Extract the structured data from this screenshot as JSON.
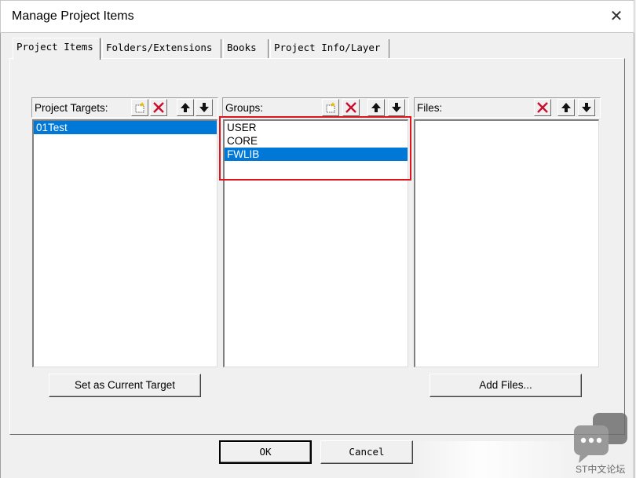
{
  "window": {
    "title": "Manage Project Items",
    "close_glyph": "✕"
  },
  "tabs": [
    {
      "label": "Project Items",
      "active": true
    },
    {
      "label": "Folders/Extensions",
      "active": false
    },
    {
      "label": "Books",
      "active": false
    },
    {
      "label": "Project Info/Layer",
      "active": false
    }
  ],
  "targets": {
    "header": "Project Targets:",
    "items": [
      {
        "label": "01Test",
        "selected": true
      }
    ],
    "toolbar": [
      "new-icon",
      "delete-icon",
      "move-up-icon",
      "move-down-icon"
    ]
  },
  "groups": {
    "header": "Groups:",
    "items": [
      {
        "label": "USER",
        "selected": false
      },
      {
        "label": "CORE",
        "selected": false
      },
      {
        "label": "FWLIB",
        "selected": true
      }
    ],
    "toolbar": [
      "new-icon",
      "delete-icon",
      "move-up-icon",
      "move-down-icon"
    ]
  },
  "files": {
    "header": "Files:",
    "items": [],
    "toolbar": [
      "delete-icon",
      "move-up-icon",
      "move-down-icon"
    ]
  },
  "buttons": {
    "set_current": "Set as Current Target",
    "add_files": "Add Files...",
    "ok": "OK",
    "cancel": "Cancel"
  },
  "watermark": {
    "text": "ST中文论坛"
  },
  "colors": {
    "selection": "#0078d7",
    "highlight_box": "#e0141e",
    "delete_icon": "#c8102e"
  }
}
